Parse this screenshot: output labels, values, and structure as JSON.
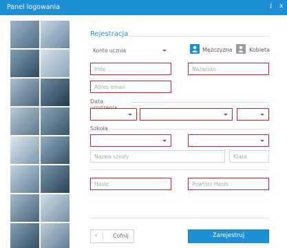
{
  "window": {
    "title": "Panel logowania",
    "info_glyph": "i",
    "close_glyph": "x"
  },
  "form": {
    "section_title": "Rejestracja",
    "account_type": "Konto ucznia",
    "gender": {
      "male": "Mężczyzna",
      "female": "Kobieta"
    },
    "first_name_placeholder": "Imię",
    "last_name_placeholder": "Nazwisko",
    "email_placeholder": "Adres email",
    "dob_label": "Data urodzenia",
    "school_label": "Szkoła",
    "school_name_placeholder": "Nazwa szkoły",
    "class_placeholder": "Klasa",
    "password_placeholder": "Hasło",
    "repeat_password_placeholder": "Powtórz Hasło",
    "back_label": "Cofnij",
    "back_glyph": "‹",
    "register_label": "Zarejestruj"
  },
  "colors": {
    "accent": "#1c8fd6",
    "error": "#e0162b"
  }
}
